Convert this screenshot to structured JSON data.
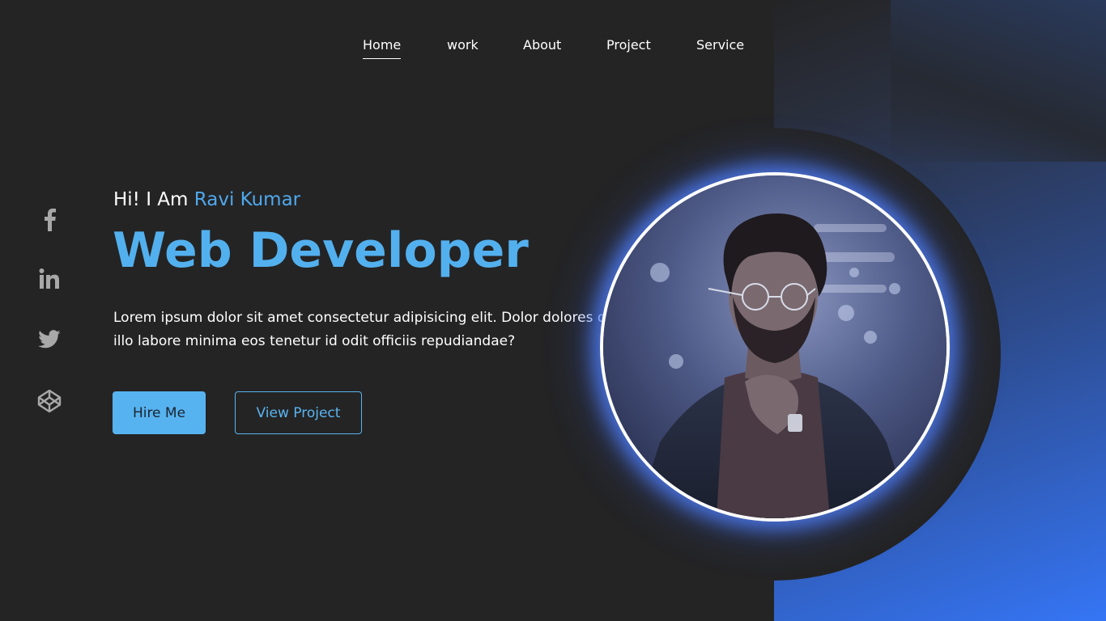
{
  "nav": {
    "items": [
      {
        "label": "Home",
        "active": true
      },
      {
        "label": "work",
        "active": false
      },
      {
        "label": "About",
        "active": false
      },
      {
        "label": "Project",
        "active": false
      },
      {
        "label": "Service",
        "active": false
      }
    ]
  },
  "social": {
    "icons": [
      "facebook-icon",
      "linkedin-icon",
      "twitter-icon",
      "codepen-icon"
    ],
    "color": "#a8a8a8"
  },
  "hero": {
    "greeting_prefix": "Hi! I Am",
    "name": "Ravi Kumar",
    "title": "Web Developer",
    "description": "Lorem ipsum dolor sit amet consectetur adipisicing elit. Dolor dolores dicta illo labore minima eos tenetur id odit officiis repudiandae?",
    "hire_label": "Hire Me",
    "view_label": "View Project"
  },
  "colors": {
    "background": "#242425",
    "accent": "#53b0ee",
    "gradient_end": "#3575f5",
    "glow": "#5a82ff"
  }
}
